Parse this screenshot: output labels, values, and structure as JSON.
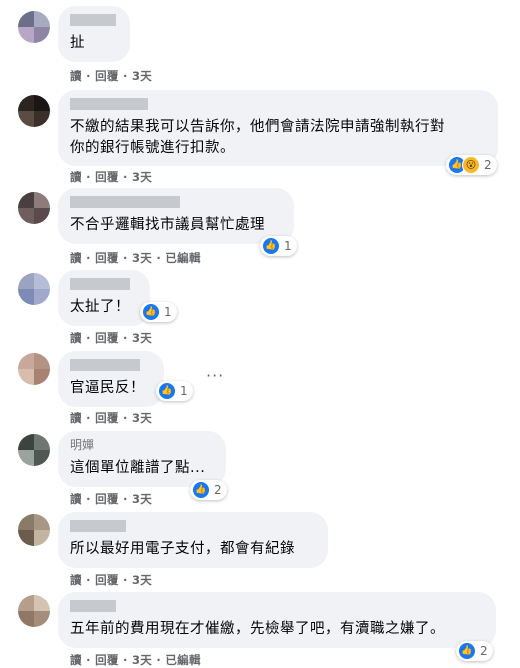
{
  "action_labels": {
    "read": "讀",
    "reply": "回覆",
    "edited": "已編輯"
  },
  "comments": [
    {
      "name": "",
      "text": "扯",
      "time": "3天"
    },
    {
      "name": "",
      "text": "不繳的結果我可以告訴你，他們會請法院申請強制執行對\n你的銀行帳號進行扣款。",
      "time": "3天",
      "reaction_count": "2"
    },
    {
      "name": "",
      "text": "不合乎邏輯找市議員幫忙處理",
      "time": "3天",
      "reaction_count": "1"
    },
    {
      "name": "",
      "text": "太扯了！",
      "time": "3天",
      "reaction_count": "1"
    },
    {
      "name": "",
      "text": "官逼民反！",
      "time": "3天",
      "reaction_count": "1"
    },
    {
      "name": "明嬋",
      "text": "這個單位離譜了點...",
      "time": "3天",
      "reaction_count": "2"
    },
    {
      "name": "",
      "text": "所以最好用電子支付，都會有紀錄",
      "time": "3天"
    },
    {
      "name": "",
      "text": "五年前的費用現在才催繳，先檢舉了吧，有瀆職之嫌了。",
      "time": "3天",
      "reaction_count": "2"
    }
  ],
  "colors": {
    "bubble": "#f0f2f5",
    "like": "#1877f2",
    "meta": "#65676b"
  },
  "icons": {
    "like": "like-icon",
    "wow": "wow-icon",
    "more": "more-options-icon"
  }
}
